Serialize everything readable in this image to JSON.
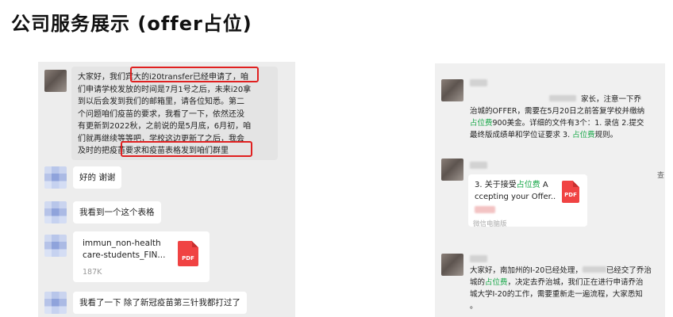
{
  "title": "公司服务展示 (offer占位)",
  "left_chat": {
    "msg1": {
      "lines": [
        "大家好，我们宾大的i20transfer已经申请了，咱",
        "们申请学校发放的时间是7月1号之后，未来i20拿",
        "到以后会发到我们的邮箱里，请各位知悉。第二",
        "个问题咱们疫苗的要求，我看了一下，依然还没",
        "有更新到2022秋，之前说的是5月底，6月初，咱",
        "们就再继续等等吧，学校这边更新了之后，我会",
        "及时的把疫苗要求和疫苗表格发到咱们群里"
      ]
    },
    "msg2": "好的 谢谢",
    "msg3": "我看到一个这个表格",
    "file": {
      "name_line1": "immun_non-health",
      "name_line2": "care-students_FIN...",
      "size": "187K",
      "icon_label": "PDF"
    },
    "msg4": "我看了一下 除了新冠疫苗第三针我都打过了"
  },
  "right_chat": {
    "msg1": {
      "lines": [
        [
          "家长，注意一下乔"
        ],
        [
          "治城的OFFER，需要在5月20日之前答复学校并缴纳"
        ],
        [
          "占位费",
          "900美金。详细的文件有3个：1. 录信 2.提交"
        ],
        [
          "最终版成绩单和学位证要求 3. ",
          "占位费",
          "规则。"
        ]
      ]
    },
    "file": {
      "title_prefix": "3. 关于接受",
      "title_green": "占位费",
      "title_suffix": " A",
      "title_line2": "ccepting your Offer..",
      "icon_label": "PDF",
      "source": "微信电脑版"
    },
    "msg3": {
      "line1_a": "大家好，南加州的I-20已经处理，",
      "line1_b": "已经交了乔治",
      "line2_a": "城的",
      "line2_green": "占位费",
      "line2_b": "，决定去乔治城，我们正在进行申请乔治",
      "line3": "城大学I-20的工作，需要重新走一遍流程，大家悉知",
      "line4": "。"
    },
    "side_label": "查"
  }
}
